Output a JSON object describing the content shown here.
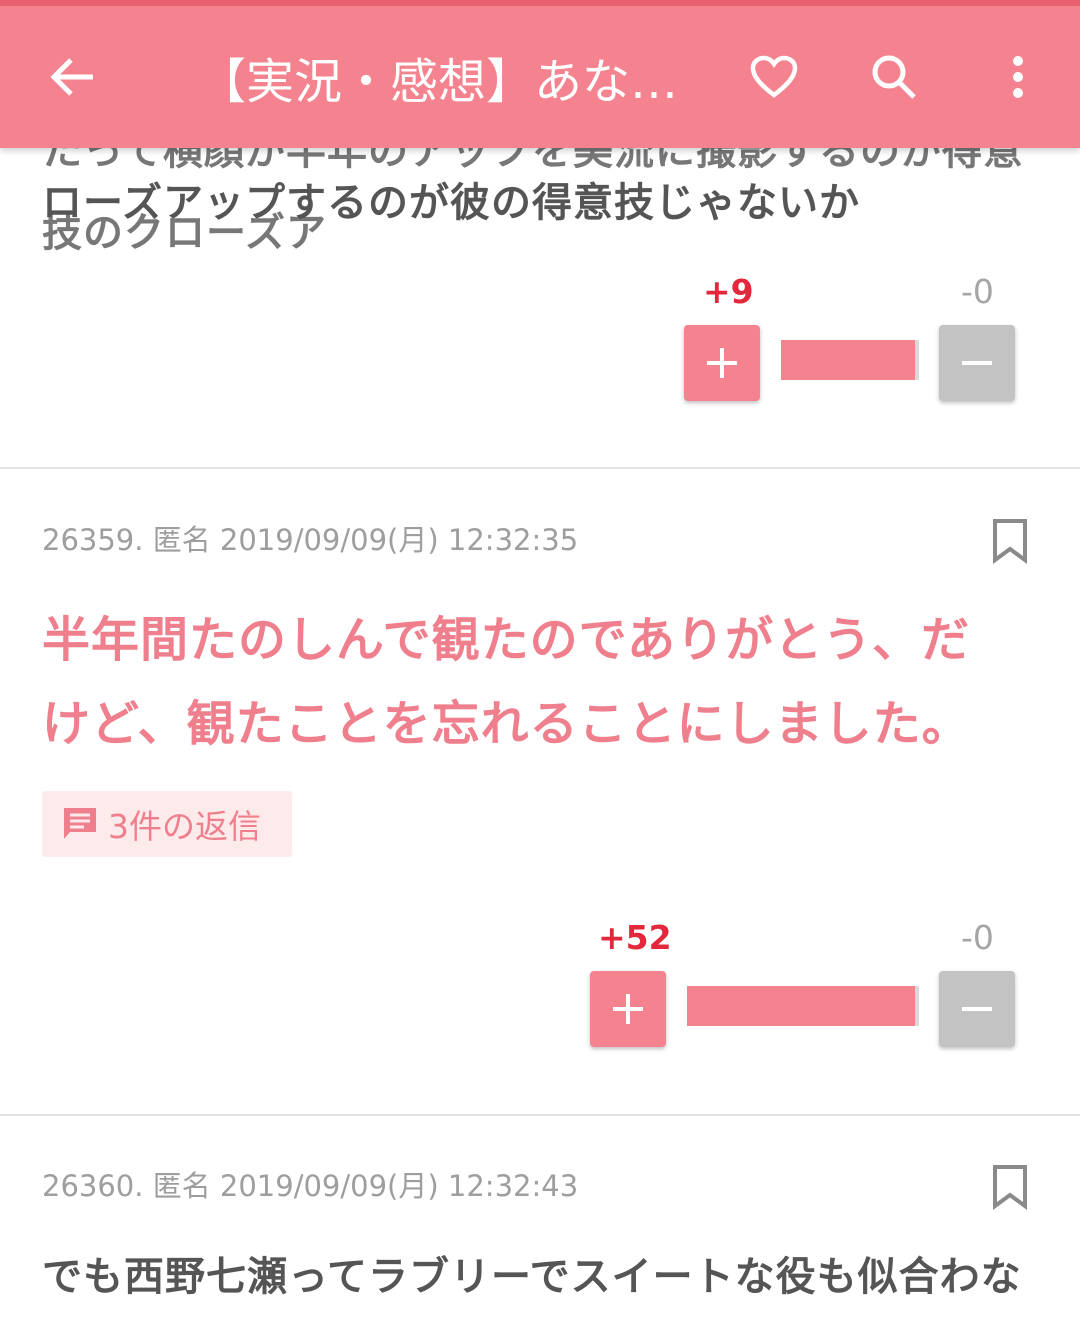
{
  "appbar": {
    "title": "【実況・感想】あな…",
    "icons": [
      "back-arrow-icon",
      "heart-icon",
      "search-icon",
      "more-vert-icon"
    ],
    "color": "#f5838f"
  },
  "comments": [
    {
      "partial_top_text": "ローズアップするのが彼の得意技じゃないか",
      "votes": {
        "plus": "+9",
        "minus": "-0",
        "ratio": 1.0
      }
    },
    {
      "meta": "26359. 匿名 2019/09/09(月) 12:32:35",
      "text_line1": "半年間たのしんで観たのでありがとう、だ",
      "text_line2": "けど、観たことを忘れることにしました。",
      "reply_label": "3件の返信",
      "votes": {
        "plus": "+52",
        "minus": "-0",
        "ratio": 1.0
      }
    },
    {
      "meta": "26360. 匿名 2019/09/09(月) 12:32:43",
      "text_line1": "でも西野七瀬ってラブリーでスイートな役も似合わな"
    }
  ],
  "colors": {
    "accent": "#f5838f",
    "plus_count": "#e3283c",
    "minus_button": "#c3c3c3",
    "text": "#555555"
  }
}
